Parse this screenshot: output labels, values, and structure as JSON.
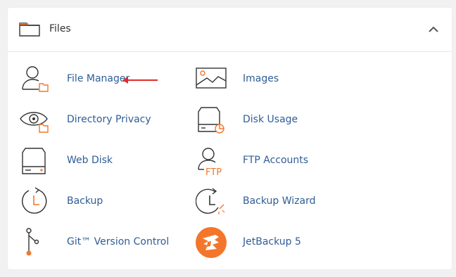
{
  "section": {
    "title": "Files",
    "accent_color": "#f3762b",
    "link_color": "#2f5d95"
  },
  "items": [
    {
      "label": "File Manager",
      "icon": "file-manager-icon"
    },
    {
      "label": "Images",
      "icon": "images-icon"
    },
    {
      "label": "Directory Privacy",
      "icon": "directory-privacy-icon"
    },
    {
      "label": "Disk Usage",
      "icon": "disk-usage-icon"
    },
    {
      "label": "Web Disk",
      "icon": "web-disk-icon"
    },
    {
      "label": "FTP Accounts",
      "icon": "ftp-accounts-icon"
    },
    {
      "label": "Backup",
      "icon": "backup-icon"
    },
    {
      "label": "Backup Wizard",
      "icon": "backup-wizard-icon"
    },
    {
      "label": "Git™ Version Control",
      "icon": "git-icon"
    },
    {
      "label": "JetBackup 5",
      "icon": "jetbackup-icon"
    }
  ],
  "ftp_icon_text": "FTP"
}
